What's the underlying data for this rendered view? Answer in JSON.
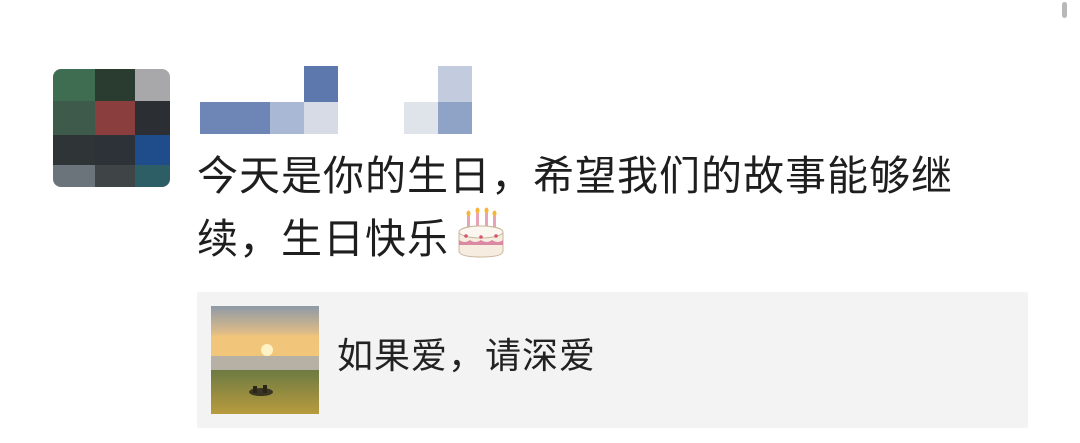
{
  "post": {
    "text": "今天是你的生日，希望我们的故事能够继续，生日快乐",
    "emoji": "birthday-cake-icon"
  },
  "link_card": {
    "title": "如果爱，请深爱",
    "thumbnail": "sunset-lake-thumbnail"
  },
  "colors": {
    "text": "#1e1e1e",
    "card_background": "#f3f3f3",
    "mosaic_blue": "#6c85b3"
  }
}
